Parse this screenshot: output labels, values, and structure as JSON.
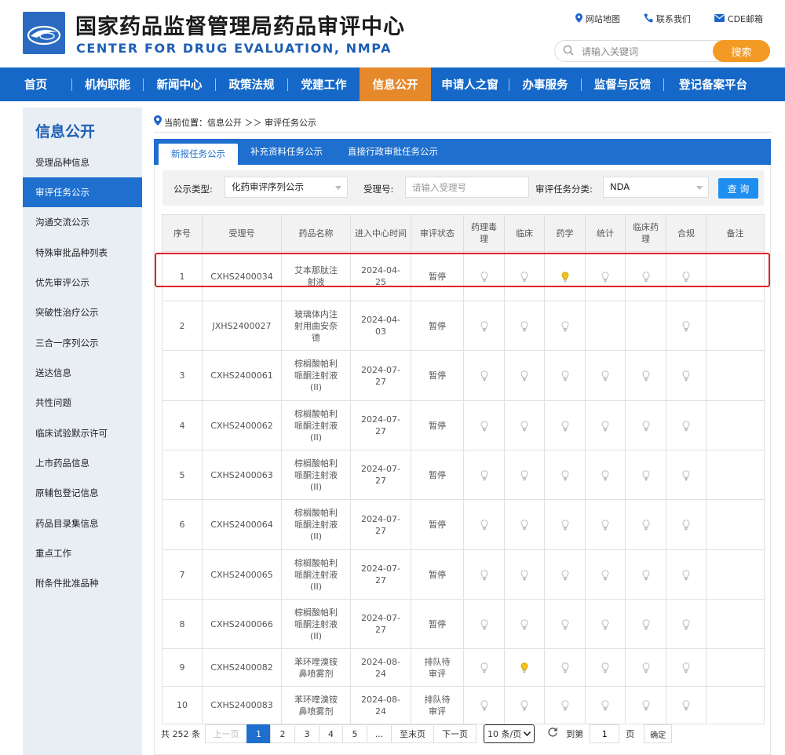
{
  "header": {
    "title_cn": "国家药品监督管理局药品审评中心",
    "title_en": "CENTER FOR DRUG EVALUATION, NMPA",
    "links": [
      {
        "label": "网站地图",
        "icon": "location-pin-icon"
      },
      {
        "label": "联系我们",
        "icon": "phone-icon"
      },
      {
        "label": "CDE邮箱",
        "icon": "mail-icon"
      }
    ],
    "search_placeholder": "请输入关键词",
    "search_button": "搜索"
  },
  "nav": {
    "items": [
      "首页",
      "机构职能",
      "新闻中心",
      "政策法规",
      "党建工作",
      "信息公开",
      "申请人之窗",
      "办事服务",
      "监督与反馈",
      "登记备案平台"
    ],
    "active": "信息公开"
  },
  "sidebar": {
    "title": "信息公开",
    "items": [
      "受理品种信息",
      "审评任务公示",
      "沟通交流公示",
      "特殊审批品种列表",
      "优先审评公示",
      "突破性治疗公示",
      "三合一序列公示",
      "送达信息",
      "共性问题",
      "临床试验默示许可",
      "上市药品信息",
      "原辅包登记信息",
      "药品目录集信息",
      "重点工作",
      "附条件批准品种"
    ],
    "active": "审评任务公示"
  },
  "breadcrumb": {
    "prefix": "当前位置：信息公开 ＞＞ 审评任务公示"
  },
  "tabs": [
    "新报任务公示",
    "补充资料任务公示",
    "直接行政审批任务公示"
  ],
  "filters": {
    "type_label": "公示类型:",
    "type_value": "化药审评序列公示",
    "accept_label": "受理号:",
    "accept_placeholder": "请输入受理号",
    "task_label": "审评任务分类:",
    "task_value": "NDA",
    "query_button": "查 询"
  },
  "table": {
    "headers": [
      "序号",
      "受理号",
      "药品名称",
      "进入中心时间",
      "审评状态",
      "药理毒理",
      "临床",
      "药学",
      "统计",
      "临床药理",
      "合规",
      "备注"
    ],
    "rows": [
      {
        "no": "1",
        "id": "CXHS2400034",
        "name": "艾本那肽注射液",
        "date": "2024-04-25",
        "status": "暂停",
        "bulbs": [
          "off",
          "off",
          "on",
          "off",
          "off",
          "off"
        ]
      },
      {
        "no": "2",
        "id": "JXHS2400027",
        "name": "玻璃体内注射用曲安奈德",
        "date": "2024-04-03",
        "status": "暂停",
        "bulbs": [
          "off",
          "off",
          "off",
          "",
          "",
          "off"
        ]
      },
      {
        "no": "3",
        "id": "CXHS2400061",
        "name": "棕榈酸帕利哌酮注射液(II)",
        "date": "2024-07-27",
        "status": "暂停",
        "bulbs": [
          "off",
          "off",
          "off",
          "off",
          "off",
          "off"
        ]
      },
      {
        "no": "4",
        "id": "CXHS2400062",
        "name": "棕榈酸帕利哌酮注射液(II)",
        "date": "2024-07-27",
        "status": "暂停",
        "bulbs": [
          "off",
          "off",
          "off",
          "off",
          "off",
          "off"
        ]
      },
      {
        "no": "5",
        "id": "CXHS2400063",
        "name": "棕榈酸帕利哌酮注射液(II)",
        "date": "2024-07-27",
        "status": "暂停",
        "bulbs": [
          "off",
          "off",
          "off",
          "off",
          "off",
          "off"
        ]
      },
      {
        "no": "6",
        "id": "CXHS2400064",
        "name": "棕榈酸帕利哌酮注射液(II)",
        "date": "2024-07-27",
        "status": "暂停",
        "bulbs": [
          "off",
          "off",
          "off",
          "off",
          "off",
          "off"
        ]
      },
      {
        "no": "7",
        "id": "CXHS2400065",
        "name": "棕榈酸帕利哌酮注射液(II)",
        "date": "2024-07-27",
        "status": "暂停",
        "bulbs": [
          "off",
          "off",
          "off",
          "off",
          "off",
          "off"
        ]
      },
      {
        "no": "8",
        "id": "CXHS2400066",
        "name": "棕榈酸帕利哌酮注射液(II)",
        "date": "2024-07-27",
        "status": "暂停",
        "bulbs": [
          "off",
          "off",
          "off",
          "off",
          "off",
          "off"
        ]
      },
      {
        "no": "9",
        "id": "CXHS2400082",
        "name": "苯环喹溴铵鼻喷雾剂",
        "date": "2024-08-24",
        "status": "排队待审评",
        "bulbs": [
          "off",
          "on",
          "off",
          "off",
          "off",
          "off"
        ]
      },
      {
        "no": "10",
        "id": "CXHS2400083",
        "name": "苯环喹溴铵鼻喷雾剂",
        "date": "2024-08-24",
        "status": "排队待审评",
        "bulbs": [
          "off",
          "off",
          "off",
          "off",
          "off",
          "off"
        ]
      }
    ]
  },
  "pagination": {
    "total": "共 252 条",
    "prev": "上一页",
    "pages": [
      "1",
      "2",
      "3",
      "4",
      "5",
      "..."
    ],
    "active_page": "1",
    "last": "至末页",
    "next": "下一页",
    "page_size": "10 条/页",
    "goto_label": "到第",
    "goto_value": "1",
    "page_suffix": "页",
    "confirm": "确定"
  },
  "colors": {
    "nav_blue": "#1568c7",
    "accent_orange": "#e6892b",
    "search_orange": "#f39a25",
    "bulb_on": "#f2c21c",
    "highlight_red": "#e02222"
  }
}
